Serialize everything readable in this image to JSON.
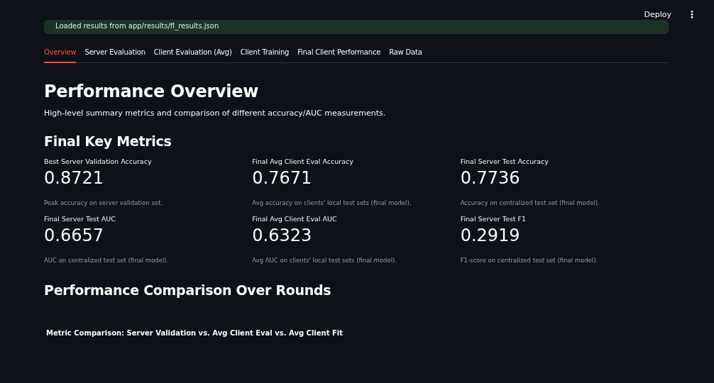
{
  "header": {
    "deploy": "Deploy",
    "menu": "⋮"
  },
  "alert": {
    "text": "Loaded results from app/results/fl_results.json"
  },
  "tabs": [
    {
      "label": "Overview",
      "selected": true
    },
    {
      "label": "Server Evaluation",
      "selected": false
    },
    {
      "label": "Client Evaluation (Avg)",
      "selected": false
    },
    {
      "label": "Client Training",
      "selected": false
    },
    {
      "label": "Final Client Performance",
      "selected": false
    },
    {
      "label": "Raw Data",
      "selected": false
    }
  ],
  "title": "Performance Overview",
  "subtitle": "High-level summary metrics and comparison of different accuracy/AUC measurements.",
  "metrics_heading": "Final Key Metrics",
  "metrics": [
    {
      "label": "Best Server Validation Accuracy",
      "value": "0.8721",
      "help": "Peak accuracy on server validation set."
    },
    {
      "label": "Final Avg Client Eval Accuracy",
      "value": "0.7671",
      "help": "Avg accuracy on clients' local test sets (final model)."
    },
    {
      "label": "Final Server Test Accuracy",
      "value": "0.7736",
      "help": "Accuracy on centralized test set (final model)."
    },
    {
      "label": "Final Server Test AUC",
      "value": "0.6657",
      "help": "AUC on centralized test set (final model)."
    },
    {
      "label": "Final Avg Client Eval AUC",
      "value": "0.6323",
      "help": "Avg AUC on clients' local test sets (final model)."
    },
    {
      "label": "Final Server Test F1",
      "value": "0.2919",
      "help": "F1-score on centralized test set (final model)."
    }
  ],
  "comparison_heading": "Performance Comparison Over Rounds",
  "chart_title": "Metric Comparison: Server Validation vs. Avg Client Eval vs. Avg Client Fit"
}
